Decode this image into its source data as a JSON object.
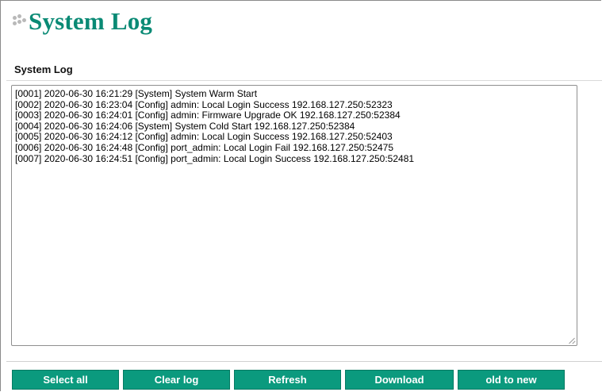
{
  "header": {
    "title": "System Log",
    "logo_icon": "moxa-dots-icon"
  },
  "section": {
    "title": "System Log"
  },
  "log": {
    "lines": [
      "[0001] 2020-06-30 16:21:29 [System] System Warm Start",
      "[0002] 2020-06-30 16:23:04 [Config] admin: Local Login Success 192.168.127.250:52323",
      "[0003] 2020-06-30 16:24:01 [Config] admin: Firmware Upgrade OK 192.168.127.250:52384",
      "[0004] 2020-06-30 16:24:06 [System] System Cold Start 192.168.127.250:52384",
      "[0005] 2020-06-30 16:24:12 [Config] admin: Local Login Success 192.168.127.250:52403",
      "[0006] 2020-06-30 16:24:48 [Config] port_admin: Local Login Fail 192.168.127.250:52475",
      "[0007] 2020-06-30 16:24:51 [Config] port_admin: Local Login Success 192.168.127.250:52481"
    ]
  },
  "buttons": {
    "select_all": "Select all",
    "clear_log": "Clear log",
    "refresh": "Refresh",
    "download": "Download",
    "order": "old to new"
  },
  "colors": {
    "title": "#0a8a75",
    "button_bg": "#0b9a7e",
    "button_text": "#ffffff"
  }
}
